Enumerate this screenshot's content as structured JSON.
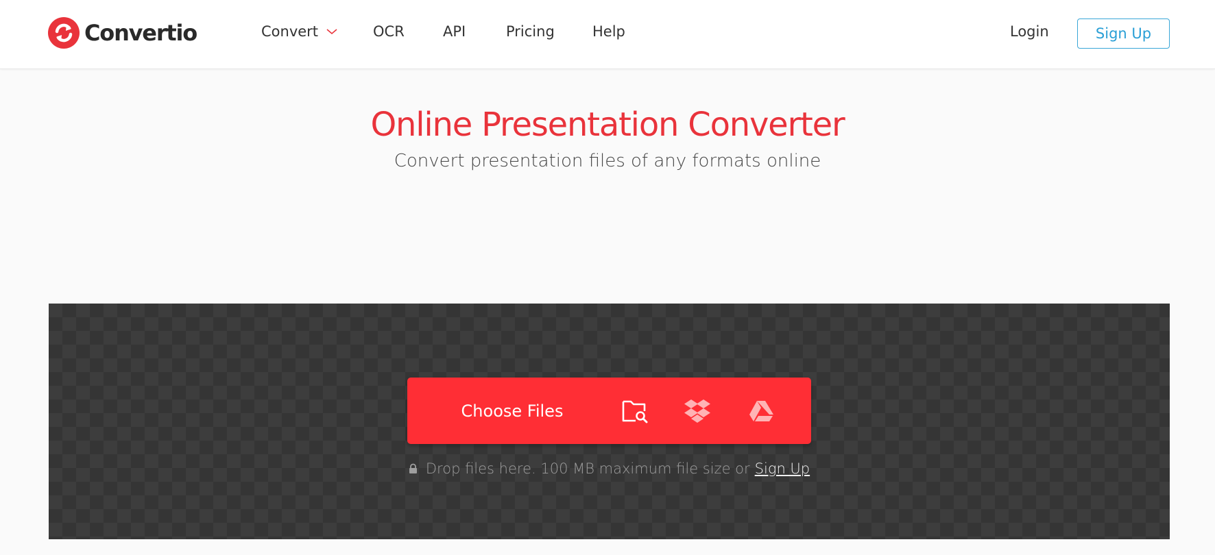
{
  "header": {
    "brand": "Convertio",
    "nav": {
      "convert": "Convert",
      "ocr": "OCR",
      "api": "API",
      "pricing": "Pricing",
      "help": "Help"
    },
    "login_label": "Login",
    "signup_label": "Sign Up"
  },
  "hero": {
    "title": "Online Presentation Converter",
    "subtitle": "Convert presentation files of any formats online"
  },
  "upload": {
    "choose_label": "Choose Files",
    "sources": [
      "folder-search-icon",
      "dropbox-icon",
      "google-drive-icon"
    ],
    "note_text": "Drop files here. 100 MB maximum file size or",
    "note_link": "Sign Up"
  },
  "colors": {
    "brand_red": "#e9333b",
    "button_red": "#ff2e35",
    "link_blue": "#2a9fd6",
    "dropzone_bg": "#3d3d3d"
  }
}
